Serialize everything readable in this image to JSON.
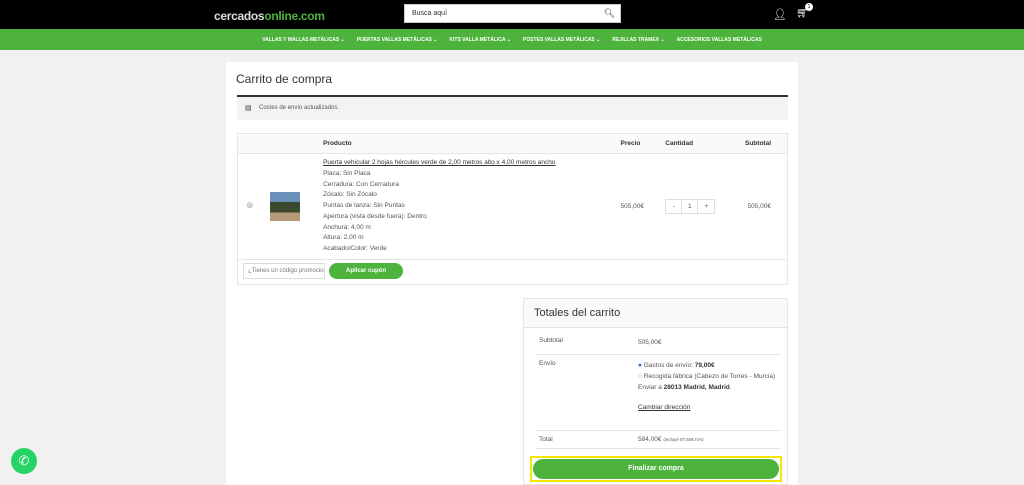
{
  "header": {
    "logo_prefix": "cercados",
    "logo_suffix": "online.com",
    "search_placeholder": "Busca aquí",
    "cart_count": "1"
  },
  "nav": [
    "VALLAS Y MALLAS METÁLICAS ⌄",
    "PUERTAS VALLAS METÁLICAS ⌄",
    "KITS VALLA METÁLICA ⌄",
    "POSTES VALLAS METÁLICAS ⌄",
    "REJILLAS TRAMEX ⌄",
    "ACCESORIOS VALLAS METÁLICAS"
  ],
  "page_title": "Carrito de compra",
  "notice": "Costes de envío actualizados.",
  "table": {
    "headers": [
      "Producto",
      "Precio",
      "Cantidad",
      "Subtotal"
    ],
    "item": {
      "name": "Puerta vehicular 2 hojas hércules verde de 2,00 metros alto x 4,00 metros ancho",
      "meta": [
        "Placa: Sin Placa",
        "Cerradura: Con Cerradura",
        "Zócalo: Sin Zócalo",
        "Puntas de lanza: Sin Puntas",
        "Apertura (vista desde fuera): Dentro",
        "Anchura: 4,00 m",
        "Altura: 2,00 m",
        "Acabado/Color: Verde"
      ],
      "price": "505,00€",
      "qty": "1",
      "subtotal": "505,00€"
    }
  },
  "coupon": {
    "placeholder": "¿Tienes un código promocional?",
    "apply": "Aplicar cupón"
  },
  "totals": {
    "title": "Totales del carrito",
    "subtotal_label": "Subtotal",
    "subtotal": "505,00€",
    "shipping_label": "Envío",
    "opt1": "Gastos de envío: ",
    "opt1_price": "79,00€",
    "opt2": "Recogida fábrica (Cabezo de Torres - Murcia)",
    "ship_to": "Enviar a ",
    "ship_addr": "28013 Madrid, Madrid",
    "change": "Cambiar dirección",
    "total_label": "Total",
    "total": "584,00€",
    "tax": "(incluye 87,64€ IVA)",
    "checkout": "Finalizar compra"
  }
}
